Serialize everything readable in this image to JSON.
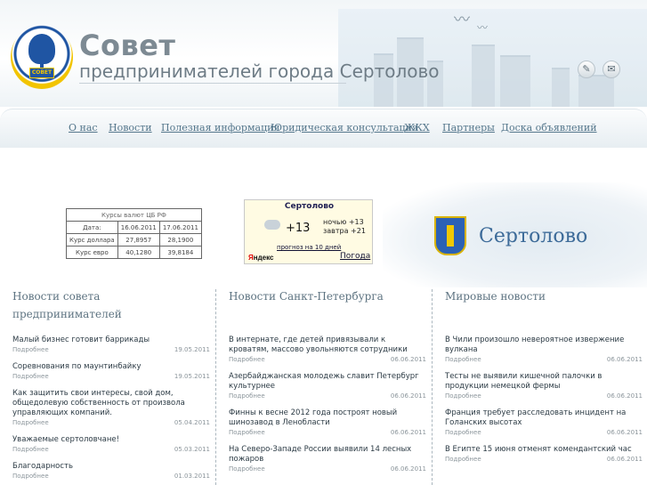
{
  "header": {
    "title": "Совет",
    "subtitle": "предпринимателей города Сертолово",
    "logo_plate": "СОВЕТ"
  },
  "nav": [
    {
      "label": "О нас"
    },
    {
      "label": "Новости"
    },
    {
      "label": "Полезная информация"
    },
    {
      "label": "Юридическая консультация"
    },
    {
      "label": "ЖКХ"
    },
    {
      "label": "Партнеры"
    },
    {
      "label": "Доска объявлений"
    }
  ],
  "rates": {
    "caption": "Курсы валют ЦБ РФ",
    "header": [
      "Дата:",
      "16.06.2011",
      "17.06.2011"
    ],
    "rows": [
      [
        "Курс доллара",
        "27,8957",
        "28,1900"
      ],
      [
        "Курс евро",
        "40,1280",
        "39,8184"
      ]
    ]
  },
  "weather": {
    "city": "Сертолово",
    "temp": "+13",
    "night": "ночью +13",
    "tomorrow": "завтра +21",
    "forecast_link": "прогноз на 10 дней",
    "brand_first": "Я",
    "brand_rest": "ндекс",
    "pogoda_link": "Погода"
  },
  "banner": {
    "name": "Сертолово"
  },
  "columns": [
    {
      "title": "Новости совета предпринимателей",
      "items": [
        {
          "headline": "Малый бизнес готовит баррикады",
          "more": "Подробнее",
          "date": "19.05.2011"
        },
        {
          "headline": "Соревнования по маунтинбайку",
          "more": "Подробнее",
          "date": "19.05.2011"
        },
        {
          "headline": "Как защитить свои интересы, свой дом, общедолевую собственность от произвола управляющих компаний.",
          "more": "Подробнее",
          "date": "05.04.2011"
        },
        {
          "headline": "Уважаемые сертоловчане!",
          "more": "Подробнее",
          "date": "05.03.2011"
        },
        {
          "headline": "Благодарность",
          "more": "Подробнее",
          "date": "01.03.2011"
        }
      ]
    },
    {
      "title": "Новости Санкт-Петербурга",
      "items": [
        {
          "headline": "В интернате, где детей привязывали к кроватям, массово увольняются сотрудники",
          "more": "Подробнее",
          "date": "06.06.2011"
        },
        {
          "headline": "Азербайджанская молодежь славит Петербург культурнее",
          "more": "Подробнее",
          "date": "06.06.2011"
        },
        {
          "headline": "Финны к весне 2012 года построят новый шинозавод в Ленобласти",
          "more": "Подробнее",
          "date": "06.06.2011"
        },
        {
          "headline": "На Северо-Западе России выявили 14 лесных пожаров",
          "more": "Подробнее",
          "date": "06.06.2011"
        }
      ]
    },
    {
      "title": "Мировые новости",
      "items": [
        {
          "headline": "В Чили произошло невероятное извержение вулкана",
          "more": "Подробнее",
          "date": "06.06.2011"
        },
        {
          "headline": "Тесты не выявили кишечной палочки в продукции немецкой фермы",
          "more": "Подробнее",
          "date": "06.06.2011"
        },
        {
          "headline": "Франция требует расследовать инцидент на Голанских высотах",
          "more": "Подробнее",
          "date": "06.06.2011"
        },
        {
          "headline": "В Египте 15 июня отменят комендантский час",
          "more": "Подробнее",
          "date": "06.06.2011"
        }
      ]
    }
  ]
}
